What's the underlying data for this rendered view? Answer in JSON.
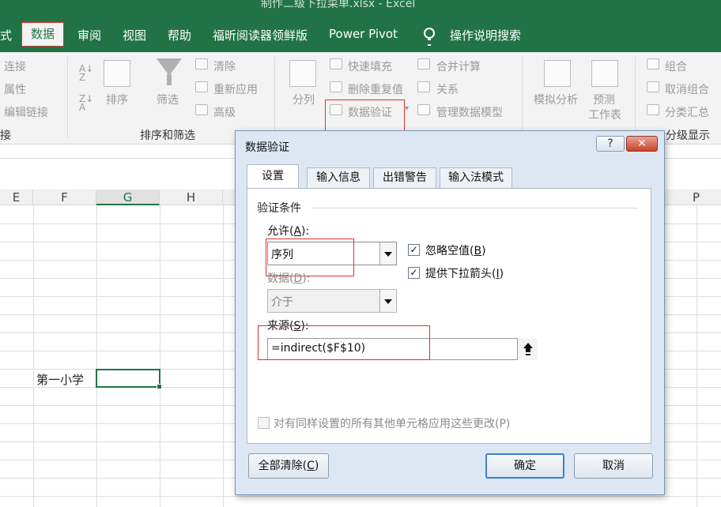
{
  "app": {
    "title_fragment": "制作二级下拉菜单.xlsx  -  Excel"
  },
  "menu": {
    "items": [
      "式",
      "数据",
      "审阅",
      "视图",
      "帮助",
      "福昕阅读器领鲜版",
      "Power Pivot",
      "操作说明搜索"
    ],
    "active": "数据"
  },
  "ribbon": {
    "connections": {
      "items": [
        "连接",
        "属性",
        "编辑链接"
      ],
      "group_label": "接"
    },
    "sort_filter": {
      "sort_label": "排序",
      "filter_label": "筛选",
      "clear_label": "清除",
      "reapply_label": "重新应用",
      "advanced_label": "高级",
      "group_label": "排序和筛选"
    },
    "data_tools": {
      "split_label": "分列",
      "flash_fill_label": "快速填充",
      "remove_dup_label": "删除重复值",
      "validation_label": "数据验证",
      "consolidate_label": "合并计算",
      "relations_label": "关系",
      "data_model_label": "管理数据模型"
    },
    "forecast": {
      "whatif_label": "模拟分析",
      "forecast_label_1": "预测",
      "forecast_label_2": "工作表"
    },
    "outline": {
      "group_btn": "组合",
      "ungroup_btn": "取消组合",
      "subtotal_btn": "分类汇总",
      "group_label": "分级显示"
    }
  },
  "sheet": {
    "columns": [
      "E",
      "F",
      "G",
      "H",
      "P"
    ],
    "selected_column": "G",
    "cell_text": "第一小学"
  },
  "dialog": {
    "title": "数据验证",
    "help_symbol": "?",
    "close_symbol": "✕",
    "tabs": [
      "设置",
      "输入信息",
      "出错警告",
      "输入法模式"
    ],
    "active_tab": "设置",
    "criteria_label": "验证条件",
    "allow": {
      "label": "允许(",
      "accel": "A",
      "label_end": "):",
      "value": "序列"
    },
    "data": {
      "label": "数据(",
      "accel": "D",
      "label_end": "):",
      "value": "介于"
    },
    "ignore_blank": {
      "label": "忽略空值(",
      "accel": "B",
      "label_end": ")",
      "checked": true
    },
    "dropdown_arrow": {
      "label": "提供下拉箭头(",
      "accel": "I",
      "label_end": ")",
      "checked": true
    },
    "source": {
      "label": "来源(",
      "accel": "S",
      "label_end": "):",
      "value": "=indirect($F$10)"
    },
    "apply_all": {
      "label": "对有同样设置的所有其他单元格应用这些更改(P)",
      "checked": false
    },
    "clear_all": {
      "label": "全部清除(",
      "accel": "C",
      "label_end": ")"
    },
    "ok_label": "确定",
    "cancel_label": "取消"
  },
  "colors": {
    "excel_green": "#217346",
    "highlight_red": "#e03030",
    "dialog_bg": "#dde7f3"
  }
}
